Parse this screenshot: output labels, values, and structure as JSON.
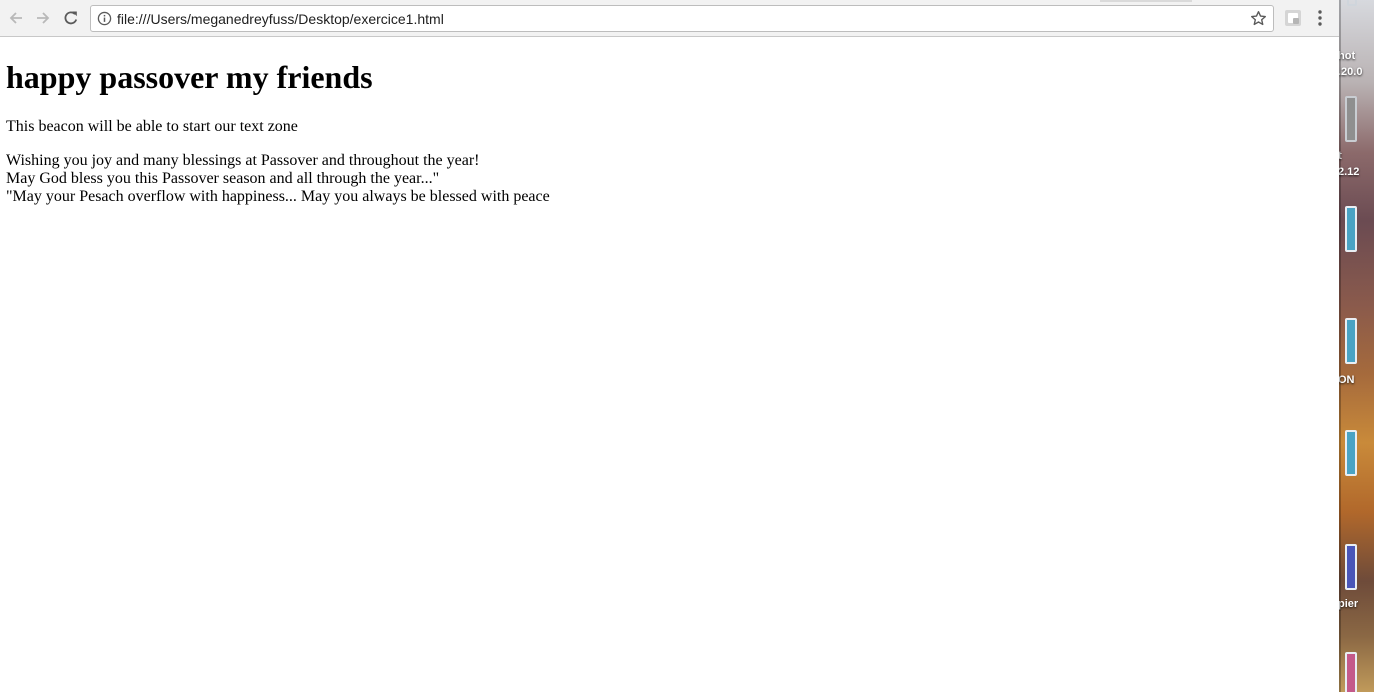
{
  "browser": {
    "url": "file:///Users/meganedreyfuss/Desktop/exercice1.html",
    "icons": {
      "back": "arrow-left-icon",
      "forward": "arrow-right-icon",
      "reload": "reload-icon",
      "site_info": "info-circle-icon",
      "bookmark": "star-icon",
      "extension": "extension-icon",
      "menu": "kebab-menu-icon"
    }
  },
  "page": {
    "heading": "happy passover my friends",
    "intro": "This beacon will be able to start our text zone",
    "wishes": [
      "Wishing you joy and many blessings at Passover and throughout the year!",
      "May God bless you this Passover season and all through the year...\"",
      "\"May your Pesach overflow with happiness... May you always be blessed with peace"
    ]
  },
  "desktop": {
    "labels": [
      "hot",
      ".20.0",
      "t",
      "2.12",
      "ON",
      "pier"
    ]
  }
}
